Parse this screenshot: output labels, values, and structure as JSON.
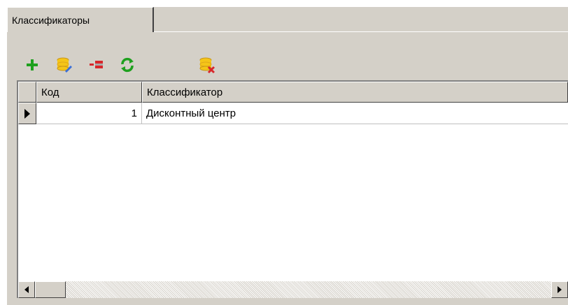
{
  "tabs": [
    {
      "label": "Классификаторы",
      "active": true
    }
  ],
  "toolbar": {
    "buttons": [
      {
        "name": "add",
        "icon": "plus-icon"
      },
      {
        "name": "edit",
        "icon": "database-edit-icon"
      },
      {
        "name": "delete",
        "icon": "delete-row-icon"
      },
      {
        "name": "refresh",
        "icon": "refresh-icon"
      },
      {
        "name": "remove-db",
        "icon": "database-delete-icon"
      }
    ]
  },
  "grid": {
    "columns": [
      "Код",
      "Классификатор"
    ],
    "rows": [
      {
        "code": "1",
        "name": "Дисконтный центр",
        "current": true
      }
    ]
  },
  "colors": {
    "accent_green": "#1ea01e",
    "accent_red": "#d8272b",
    "db_yellow": "#f5c518",
    "chrome": "#d4d0c8"
  }
}
